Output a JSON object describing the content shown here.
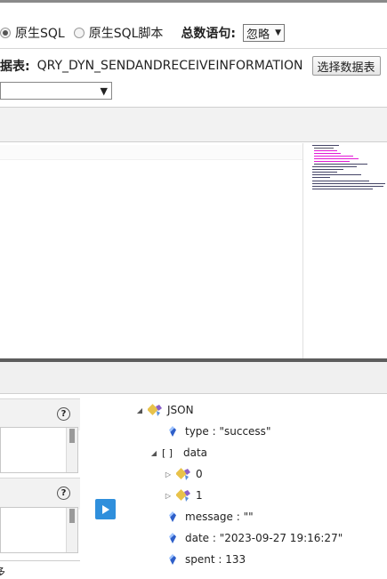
{
  "query_options": {
    "radio_sql": "原生SQL",
    "radio_sql_script": "原生SQL脚本",
    "total_label": "总数语句:",
    "total_select_value": "忽略"
  },
  "table_row": {
    "label": "据表:",
    "table_name": "QRY_DYN_SENDANDRECEIVEINFORMATION",
    "choose_button": "选择数据表"
  },
  "bottom_left": {
    "help_icon_1": "?",
    "help_icon_2": "?",
    "cut_char": "多"
  },
  "icons": {
    "radio": "radio-icon",
    "dropdown": "chevron-down-icon",
    "help": "help-icon",
    "run": "play-icon",
    "object": "json-object-icon",
    "field": "field-gem-icon"
  },
  "result_tree": {
    "root": "JSON",
    "type": "type : \"success\"",
    "data": "data",
    "data_bracket": "[ ]",
    "item0": "0",
    "item1": "1",
    "message": "message : \"\"",
    "date": "date : \"2023-09-27 19:16:27\"",
    "spent": "spent : 133"
  },
  "colors": {
    "run_button": "#2f8fdc",
    "splitter": "#5d5d5d",
    "minimap_accent": "#e21ad5"
  }
}
